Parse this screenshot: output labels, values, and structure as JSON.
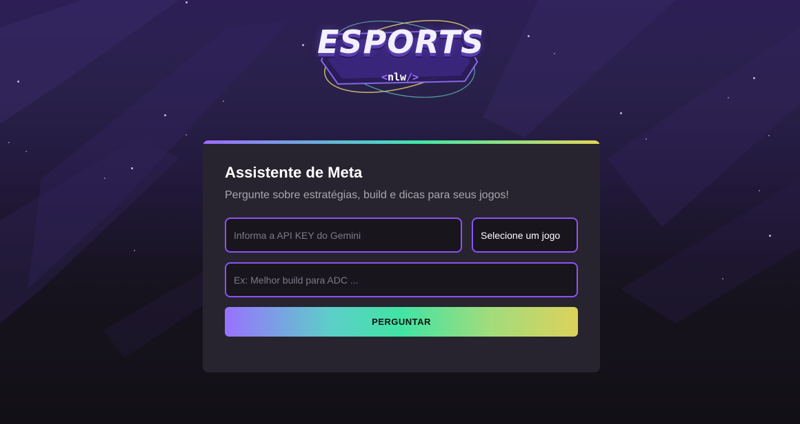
{
  "logo": {
    "title": "ESPORTS",
    "subtitle_open": "<",
    "subtitle_text": "nlw",
    "subtitle_close": "/>"
  },
  "card": {
    "title": "Assistente de Meta",
    "subtitle": "Pergunte sobre estratégias, build e dicas para seus jogos!",
    "api_key_placeholder": "Informa a API KEY do Gemini",
    "game_select_value": "Selecione um jogo",
    "question_placeholder": "Ex: Melhor build para ADC ...",
    "submit_label": "PERGUNTAR"
  },
  "colors": {
    "accent_purple": "#8b54f5",
    "card_background": "#28242f",
    "gradient_start": "#9872ff",
    "gradient_mid": "#41e4a4",
    "gradient_end": "#ddd25b"
  }
}
